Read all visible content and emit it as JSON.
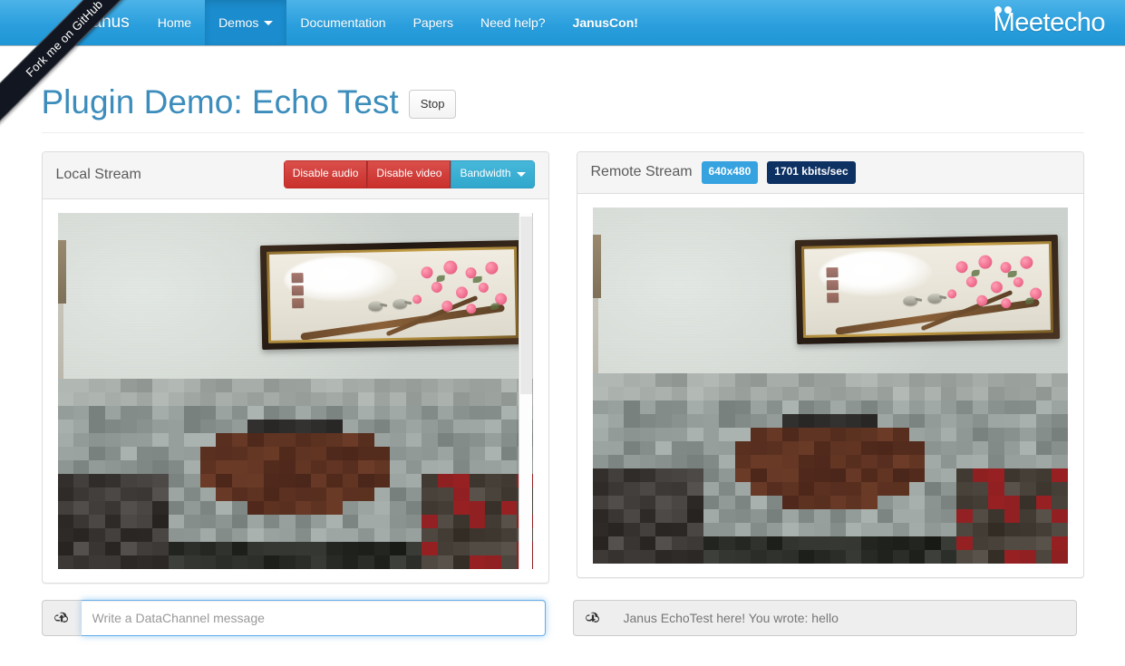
{
  "ribbon": {
    "label": "Fork me on GitHub"
  },
  "navbar": {
    "brand": "Janus",
    "items": [
      {
        "label": "Home",
        "active": false,
        "bold": false,
        "caret": false
      },
      {
        "label": "Demos",
        "active": true,
        "bold": false,
        "caret": true
      },
      {
        "label": "Documentation",
        "active": false,
        "bold": false,
        "caret": false
      },
      {
        "label": "Papers",
        "active": false,
        "bold": false,
        "caret": false
      },
      {
        "label": "Need help?",
        "active": false,
        "bold": false,
        "caret": false
      },
      {
        "label": "JanusCon!",
        "active": false,
        "bold": true,
        "caret": false
      }
    ],
    "logo": "eetecho",
    "logo_initial": "M"
  },
  "page": {
    "title": "Plugin Demo: Echo Test",
    "stop_button": "Stop"
  },
  "local_panel": {
    "title": "Local Stream",
    "buttons": {
      "disable_audio": "Disable audio",
      "disable_video": "Disable video",
      "bandwidth": "Bandwidth"
    }
  },
  "remote_panel": {
    "title": "Remote Stream",
    "resolution_badge": "640x480",
    "bitrate_badge": "1701 kbits/sec"
  },
  "datachannel": {
    "send_placeholder": "Write a DataChannel message",
    "send_value": "",
    "received_value": "Janus EchoTest here! You wrote: hello",
    "upload_icon": "cloud-upload-icon",
    "download_icon": "cloud-download-icon"
  },
  "colors": {
    "navbar_top": "#4cb3e8",
    "navbar_bottom": "#1f96d6",
    "navbar_active": "#1b8ccd",
    "title_blue": "#3c8dbc",
    "danger_red": "#c9302c",
    "info_blue": "#46b8da",
    "badge_light_blue": "#36a3e0",
    "badge_navy": "#0d3163",
    "ribbon_dark": "#121621"
  }
}
